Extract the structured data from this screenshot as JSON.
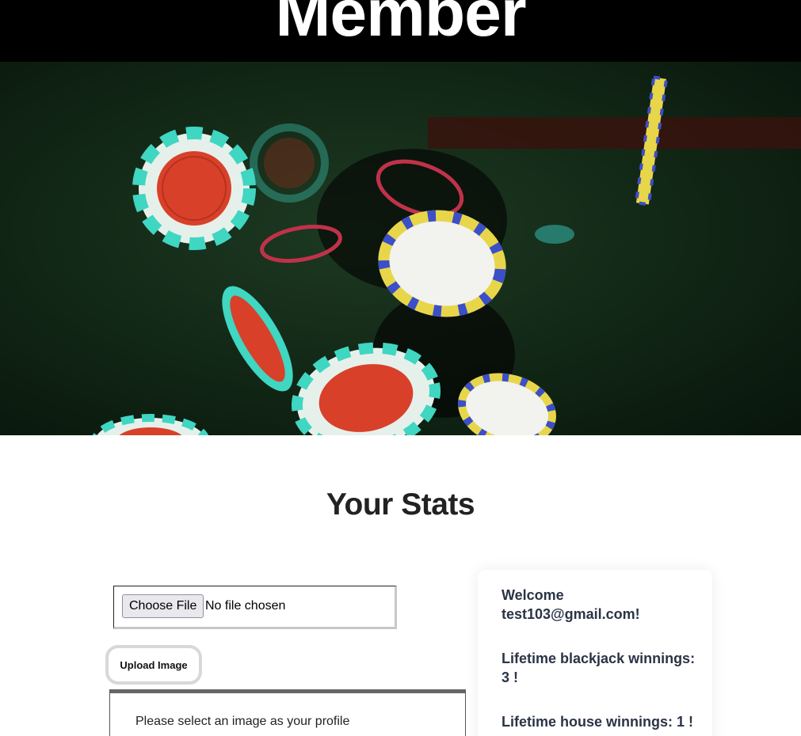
{
  "banner": {
    "title": "Member"
  },
  "stats": {
    "heading": "Your Stats",
    "upload": {
      "choose_label": "Choose File",
      "file_status": "No file chosen",
      "upload_label": "Upload Image",
      "notice": "Please select an image as your profile"
    },
    "card": {
      "welcome": "Welcome test103@gmail.com!",
      "blackjack": "Lifetime blackjack winnings: 3 !",
      "house": "Lifetime house winnings: 1 !"
    }
  },
  "colors": {
    "banner_bg": "#000000",
    "chip_red": "#d9402a",
    "chip_teal": "#3fd6c2",
    "chip_yellow": "#e8d64a",
    "chip_blue": "#3b4fc9"
  }
}
